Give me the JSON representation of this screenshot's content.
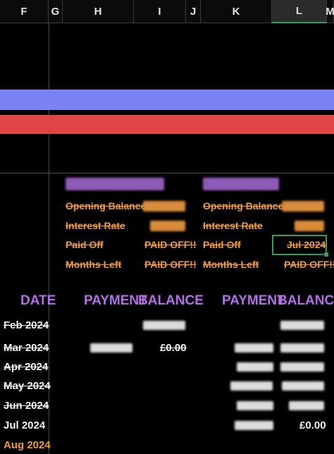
{
  "columns": [
    "F",
    "G",
    "H",
    "I",
    "J",
    "K",
    "L",
    "M"
  ],
  "colors": {
    "purple_band": "#7b82f6",
    "red_band": "#e04545",
    "orange": "#f39a3a",
    "purple_text": "#b46ee8"
  },
  "banks": {
    "left": {
      "name_redacted": "blurred bank name",
      "opening_balance_label": "Opening Balance",
      "interest_rate_label": "Interest Rate",
      "paid_off_label": "Paid Off",
      "paid_off_value": "PAID OFF!!",
      "months_left_label": "Months Left",
      "months_left_value": "PAID OFF!!"
    },
    "right": {
      "name_redacted": "blurred bank name",
      "opening_balance_label": "Opening Balance",
      "interest_rate_label": "Interest Rate",
      "paid_off_label": "Paid Off",
      "paid_off_value": "Jul 2024",
      "months_left_label": "Months Left",
      "months_left_value": "PAID OFF!!"
    }
  },
  "table": {
    "date_header": "DATE",
    "left_payment_header": "PAYMENT",
    "left_balance_header": "BALANCE",
    "right_payment_header": "PAYMENT",
    "right_balance_header": "BALANCE",
    "dates": [
      "Feb 2024",
      "Mar 2024",
      "Apr 2024",
      "May 2024",
      "Jun 2024",
      "Jul 2024",
      "Aug 2024"
    ],
    "left_balance_mar": "£0.00",
    "right_balance_jul": "£0.00"
  }
}
